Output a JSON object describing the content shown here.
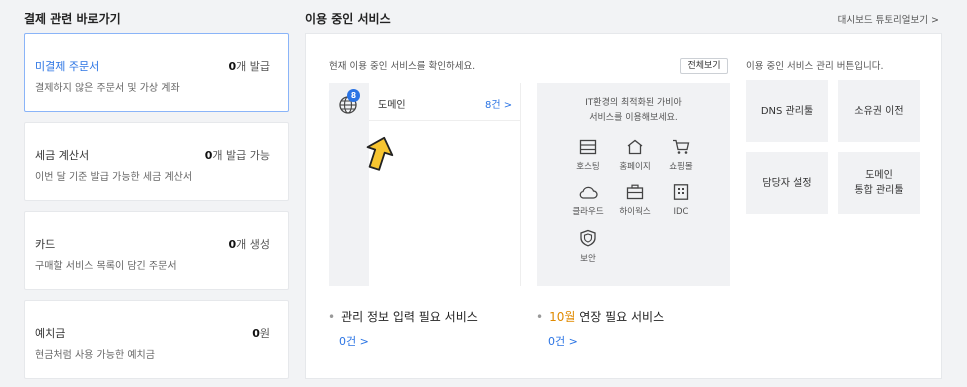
{
  "left": {
    "title": "결제 관련 바로가기",
    "cards": [
      {
        "name": "미결제 주문서",
        "count_num": "0",
        "count_unit": "개 발급",
        "desc": "결제하지 않은 주문서 및 가상 계좌"
      },
      {
        "name": "세금 계산서",
        "count_num": "0",
        "count_unit": "개 발급 가능",
        "desc": "이번 달 기준 발급 가능한 세금 계산서"
      },
      {
        "name": "카드",
        "count_num": "0",
        "count_unit": "개 생성",
        "desc": "구매할 서비스 목록이 담긴 주문서"
      },
      {
        "name": "예치금",
        "count_num": "0",
        "count_unit": "원",
        "desc": "현금처럼 사용 가능한 예치금"
      }
    ]
  },
  "right": {
    "title": "이용 중인 서비스",
    "tutorial_link": "대시보드 튜토리얼보기 >",
    "current_hint": "현재 이용 중인 서비스를 확인하세요.",
    "view_all": "전체보기",
    "domain": {
      "label": "도메인",
      "count": "8건 >",
      "badge": "8"
    },
    "promo": {
      "line1": "IT환경의 최적화된 가비아",
      "line2": "서비스를 이용해보세요.",
      "services": [
        {
          "label": "호스팅",
          "icon": "hosting-icon"
        },
        {
          "label": "홈페이지",
          "icon": "homepage-icon"
        },
        {
          "label": "쇼핑몰",
          "icon": "cart-icon"
        },
        {
          "label": "클라우드",
          "icon": "cloud-icon"
        },
        {
          "label": "하이웍스",
          "icon": "briefcase-icon"
        },
        {
          "label": "IDC",
          "icon": "idc-icon"
        },
        {
          "label": "보안",
          "icon": "shield-icon"
        }
      ]
    },
    "mgmt_hint": "이용 중인 서비스 관리 버튼입니다.",
    "mgmt_buttons": [
      {
        "line1": "DNS 관리툴",
        "line2": ""
      },
      {
        "line1": "소유권 이전",
        "line2": ""
      },
      {
        "line1": "담당자 설정",
        "line2": ""
      },
      {
        "line1": "도메인",
        "line2": "통합 관리툴"
      }
    ],
    "info1": {
      "bullet": "•",
      "title": "관리 정보 입력 필요 서비스",
      "link": "0건 >"
    },
    "info2": {
      "bullet": "•",
      "month": "10월",
      "title": " 연장 필요 서비스",
      "link": "0건 >"
    }
  },
  "colors": {
    "accent": "#2b74e4",
    "highlight": "#e08a00",
    "arrow": "#f7c531"
  }
}
